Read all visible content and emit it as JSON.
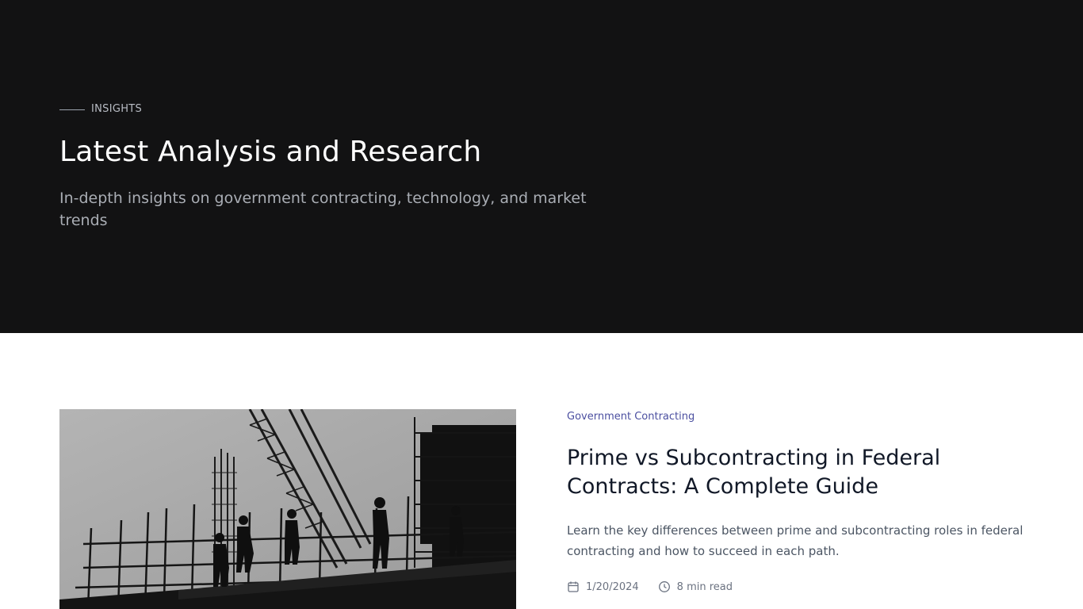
{
  "hero": {
    "eyebrow": "INSIGHTS",
    "title": "Latest Analysis and Research",
    "subtitle": "In-depth insights on government contracting, technology, and market trends"
  },
  "featured_article": {
    "image_icon": "construction-workers-photo",
    "category": "Government Contracting",
    "title": "Prime vs Subcontracting in Federal Contracts: A Complete Guide",
    "excerpt": "Learn the key differences between prime and subcontracting roles in federal contracting and how to succeed in each path.",
    "date_icon": "calendar-icon",
    "date": "1/20/2024",
    "read_time_icon": "clock-icon",
    "read_time": "8 min read"
  },
  "colors": {
    "hero_bg": "#121213",
    "category_accent": "#4b4fa0",
    "title_text": "#111827"
  }
}
